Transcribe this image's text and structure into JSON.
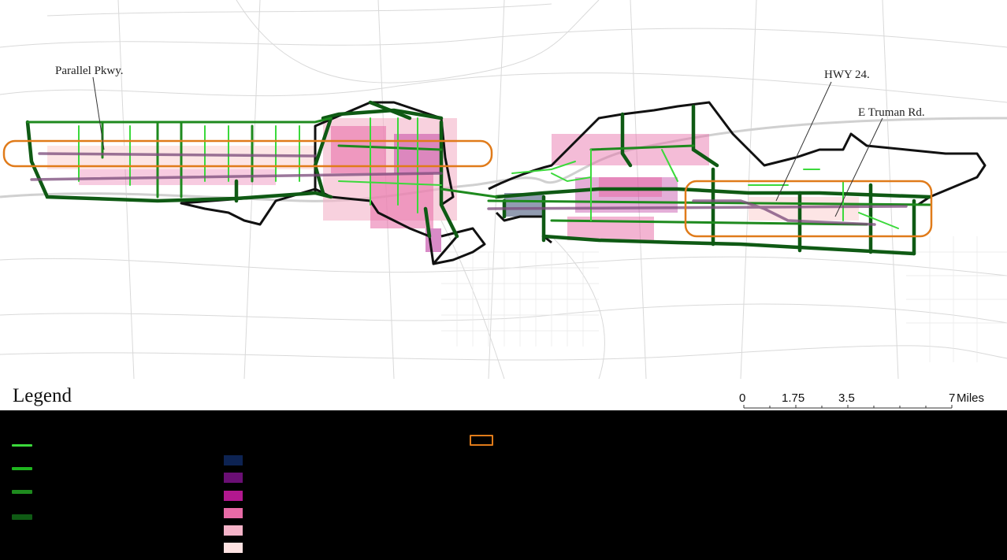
{
  "map": {
    "labels": {
      "parallel": "Parallel Pkwy.",
      "hwy24": "HWY 24.",
      "truman": "E Truman Rd."
    },
    "colors": {
      "boundary": "#111111",
      "focus_box": "#e07b1a",
      "route_light": "#3bd93b",
      "route_mid": "#1fb51f",
      "route_dark": "#1e8a1e",
      "route_darkest": "#0f5a14",
      "density_1": "#0d2352",
      "density_2": "#6a0f74",
      "density_3": "#b2188f",
      "density_4": "#e76aa6",
      "density_5": "#f4b3c8",
      "density_6": "#fde2e2"
    }
  },
  "legend": {
    "title": "Legend",
    "scale": {
      "ticks": [
        "0",
        "1.75",
        "3.5",
        "7"
      ],
      "unit": "Miles"
    }
  }
}
